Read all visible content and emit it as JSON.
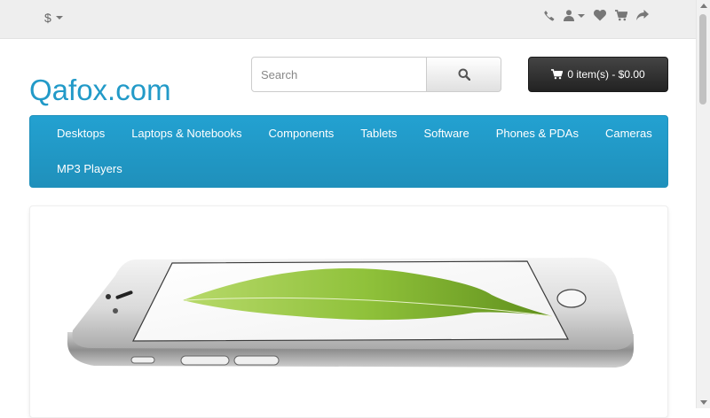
{
  "topbar": {
    "currency_symbol": "$",
    "icons": [
      "phone-icon",
      "user-icon",
      "heart-icon",
      "cart-icon",
      "share-icon"
    ]
  },
  "header": {
    "logo_text": "Qafox.com",
    "search": {
      "placeholder": "Search",
      "value": ""
    },
    "cart_label": "0 item(s) - $0.00"
  },
  "menu": {
    "items": [
      "Desktops",
      "Laptops & Notebooks",
      "Components",
      "Tablets",
      "Software",
      "Phones & PDAs",
      "Cameras",
      "MP3 Players"
    ]
  },
  "colors": {
    "brand": "#229ac8",
    "menu": "#229ac8",
    "cart_button": "#333333",
    "topbar": "#eeeeee"
  }
}
